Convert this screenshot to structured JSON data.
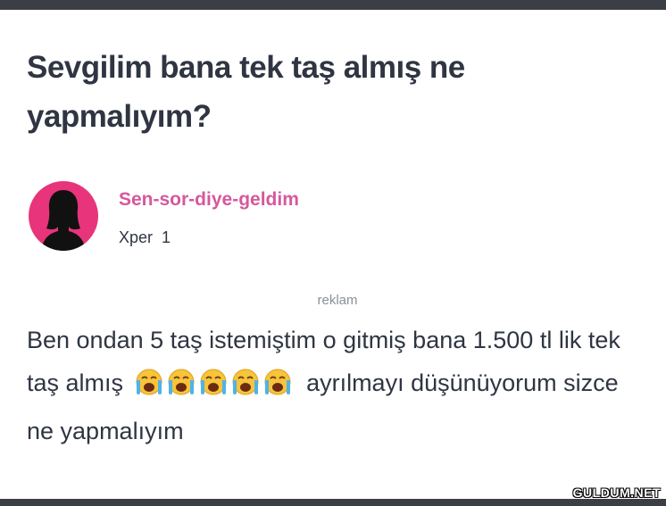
{
  "question": {
    "title": "Sevgilim bana tek taş almış ne yapmalıyım?"
  },
  "user": {
    "name": "Sen-sor-diye-geldim",
    "rank": "Xper",
    "level": "1",
    "avatar_icon": "female-silhouette-icon",
    "avatar_color": "#e8347a",
    "name_color": "#d6589c"
  },
  "ad": {
    "label": "reklam"
  },
  "body": {
    "text_before": "Ben ondan 5 taş istemiştim o gitmiş bana 1.500 tl lik tek taş almış",
    "emoji_icon": "loudly-crying-face-icon",
    "emoji_count": 5,
    "text_after": "ayrılmayı düşünüyorum sizce ne yapmalıyım"
  },
  "watermark": {
    "text": "GULDUM.NET"
  }
}
